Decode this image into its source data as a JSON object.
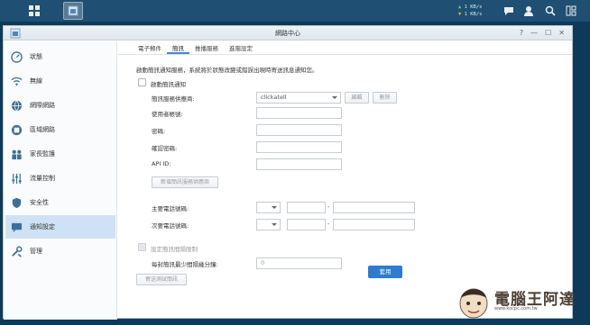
{
  "taskbar": {
    "net_up": "1 KB/s",
    "net_down": "1 KB/s"
  },
  "window": {
    "title": "網路中心",
    "controls": [
      "?",
      "—",
      "☐",
      "✕"
    ]
  },
  "sidebar": {
    "items": [
      {
        "label": "狀態",
        "icon": "speedometer-icon"
      },
      {
        "label": "無線",
        "icon": "wifi-icon"
      },
      {
        "label": "網際網路",
        "icon": "globe-icon"
      },
      {
        "label": "區域網路",
        "icon": "network-icon"
      },
      {
        "label": "家長監護",
        "icon": "family-icon"
      },
      {
        "label": "流量控制",
        "icon": "sliders-icon"
      },
      {
        "label": "安全性",
        "icon": "shield-icon"
      },
      {
        "label": "通知設定",
        "icon": "chat-icon",
        "active": true
      },
      {
        "label": "管理",
        "icon": "tools-icon"
      }
    ]
  },
  "tabs": [
    "電子郵件",
    "簡訊",
    "推播服務",
    "進階設定"
  ],
  "active_tab": "簡訊",
  "content": {
    "description": "啟動簡訊通知服務，系統將於狀態改變或錯誤出現時寄送訊息通知您。",
    "enable_sms_label": "啟動簡訊通知",
    "provider_label": "簡訊服務供應商:",
    "provider_value": "clickatell",
    "edit_label": "編輯",
    "delete_label": "刪除",
    "username_label": "使用者帳號:",
    "password_label": "密碼:",
    "confirm_password_label": "確認密碼:",
    "api_id_label": "API ID:",
    "add_provider_label": "新增簡訊服務供應商",
    "primary_phone_label": "主要電話號碼:",
    "secondary_phone_label": "次要電話號碼:",
    "interval_limit_label": "設定簡訊間隔限制",
    "interval_minutes_label": "每封簡訊最少間隔幾分鐘:",
    "interval_minutes_value": "0",
    "send_test_label": "寄送測試簡訊",
    "apply_label": "套用"
  },
  "watermark": {
    "text": "電腦王阿達",
    "url": "www.kocpc.com.tw"
  },
  "colors": {
    "accent": "#2e7bd0",
    "sidebar_active": "#cfe2f5",
    "taskbar": "#1f4f72"
  }
}
